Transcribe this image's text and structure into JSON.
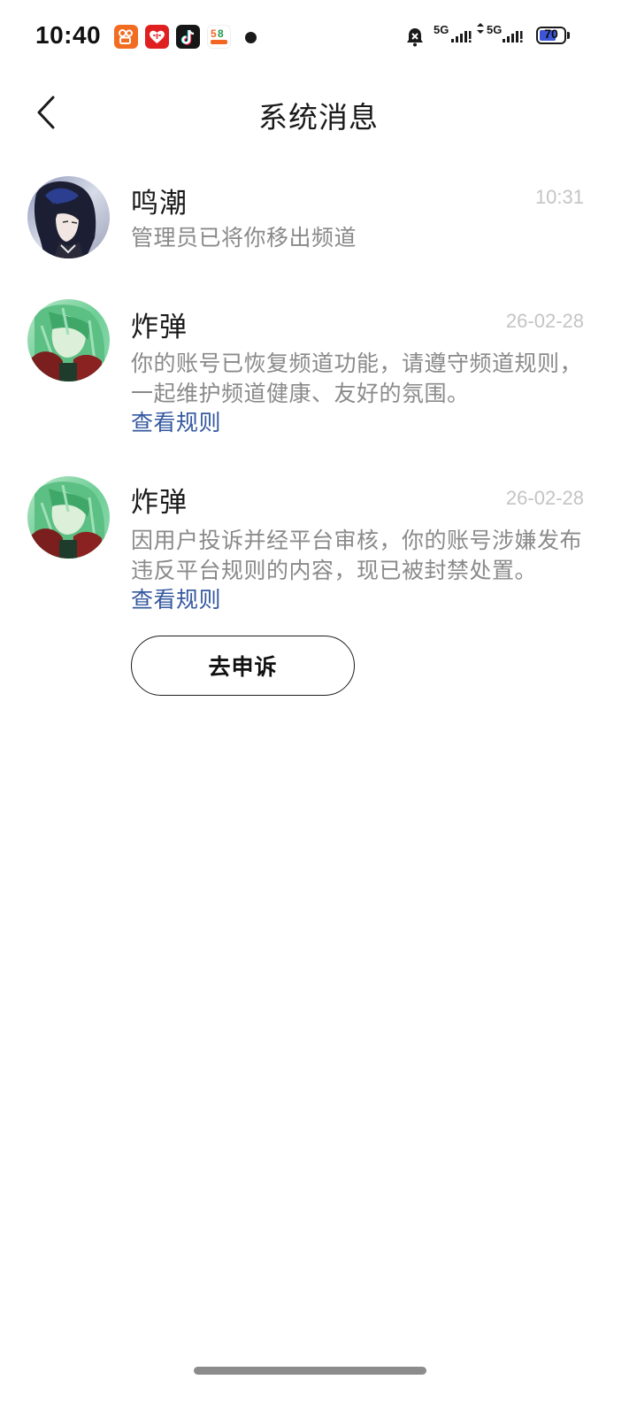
{
  "status_bar": {
    "time": "10:40",
    "apps": [
      {
        "icon": "kuaishou-app-icon",
        "color": "#f26c22"
      },
      {
        "icon": "pinduoduo-app-icon",
        "color": "#e02020"
      },
      {
        "icon": "douyin-app-icon",
        "color": "#161616"
      },
      {
        "icon": "58-app-icon",
        "label": "58",
        "color": "#ffffff"
      }
    ],
    "signal_1": "5G",
    "signal_2": "5G",
    "battery": "70",
    "battery_level": 0.7
  },
  "header": {
    "title": "系统消息",
    "back_icon": "chevron-left-icon"
  },
  "messages": [
    {
      "sender": "鸣潮",
      "time": "10:31",
      "body": "管理员已将你移出频道",
      "avatar": "dark-haired-character-avatar"
    },
    {
      "sender": "炸弹",
      "time": "26-02-28",
      "body": "你的账号已恢复频道功能，请遵守频道规则，一起维护频道健康、友好的氛围。",
      "link": "查看规则",
      "avatar": "green-haired-character-avatar"
    },
    {
      "sender": "炸弹",
      "time": "26-02-28",
      "body": "因用户投诉并经平台审核，你的账号涉嫌发布违反平台规则的内容，现已被封禁处置。",
      "link": "查看规则",
      "button": "去申诉",
      "avatar": "green-haired-character-avatar"
    }
  ],
  "colors": {
    "link": "#34589f",
    "time": "#c4c4c4",
    "body": "#8a8a8a",
    "battery_fill": "#3c55d6"
  }
}
